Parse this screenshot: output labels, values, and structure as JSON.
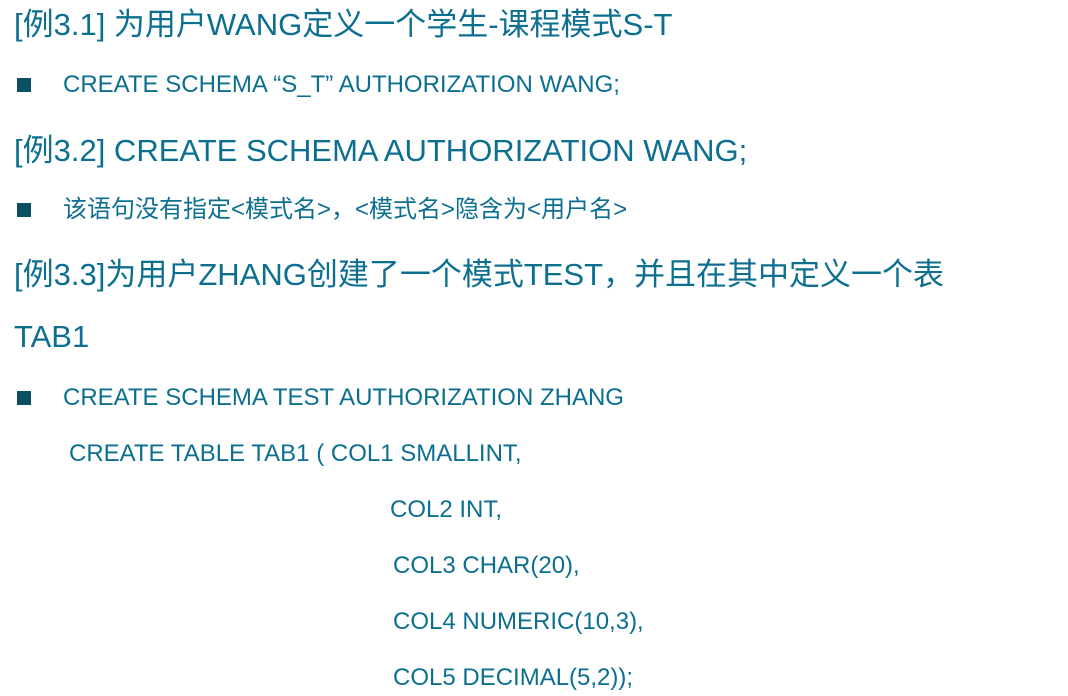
{
  "examples": {
    "ex1_title": "[例3.1] 为用户WANG定义一个学生-课程模式S-T",
    "ex1_statement": "CREATE SCHEMA “S_T” AUTHORIZATION WANG;",
    "ex2_title": "[例3.2] CREATE SCHEMA AUTHORIZATION WANG;",
    "ex2_note": "该语句没有指定<模式名>，<模式名>隐含为<用户名>",
    "ex3_title_line1": "[例3.3]为用户ZHANG创建了一个模式TEST，并且在其中定义一个表",
    "ex3_title_line2": "TAB1",
    "ex3_statement": "CREATE SCHEMA TEST AUTHORIZATION ZHANG",
    "code_lines": [
      "CREATE TABLE TAB1   ( COL1 SMALLINT,",
      "COL2 INT,",
      "COL3 CHAR(20),",
      "COL4 NUMERIC(10,3),",
      "COL5 DECIMAL(5,2));"
    ]
  },
  "colors": {
    "text": "#0d6f90",
    "bullet": "#0b4f66",
    "background": "#ffffff"
  },
  "icons": {
    "bullet": "square-bullet-icon"
  }
}
